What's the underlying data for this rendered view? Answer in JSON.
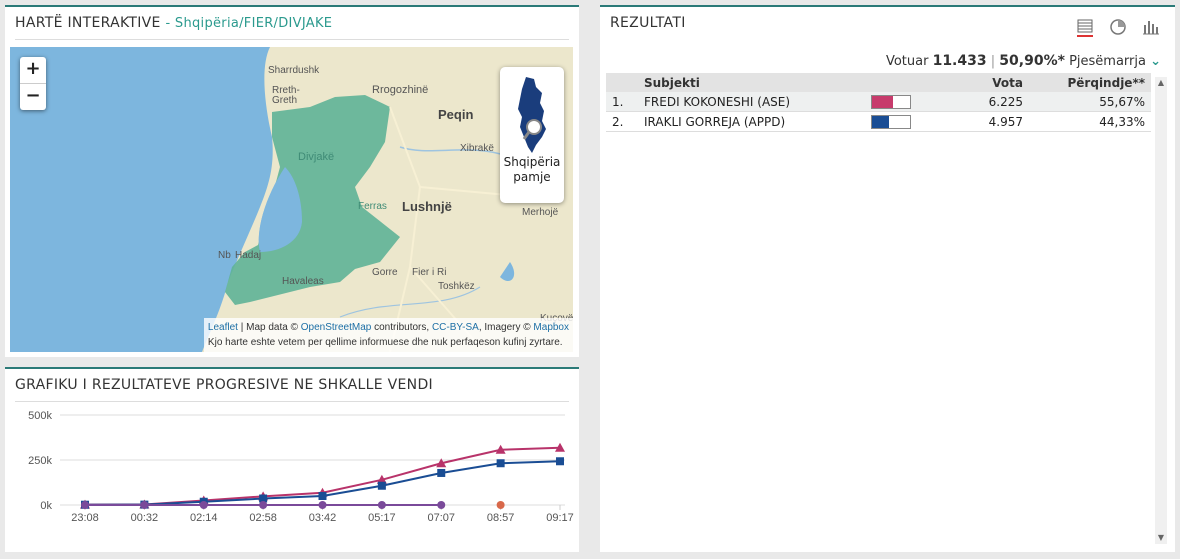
{
  "map_panel": {
    "title": "HARTË INTERAKTIVE",
    "breadcrumb": "- Shqipëria/FIER/DIVJAKE",
    "zoom_in": "+",
    "zoom_out": "−",
    "minimap_label_1": "Shqipëria",
    "minimap_label_2": "pamje",
    "places": [
      "Sharrdushk",
      "Rreth-",
      "Greth",
      "Rrogozhinë",
      "Peqin",
      "Xibrakë",
      "Divjakë",
      "Ferras",
      "Lushnjë",
      "Merhojë",
      "Hadaj",
      "Havaleas",
      "Gorre",
      "Fier i Ri",
      "Toshkëz",
      "Kuçovë",
      "Nb"
    ],
    "attr_leaflet": "Leaflet",
    "attr_mid": "| Map data ©",
    "attr_osm": "OpenStreetMap",
    "attr_contrib": "contributors,",
    "attr_cc": "CC-BY-SA",
    "attr_imagery": ", Imagery ©",
    "attr_mapbox": "Mapbox",
    "disclaimer": "Kjo harte eshte vetem per qellime informuese dhe nuk perfaqeson kufinj zyrtare."
  },
  "results_panel": {
    "title": "REZULTATI",
    "icons": [
      "table-view-icon",
      "pie-chart-icon",
      "bar-chart-icon"
    ],
    "voted_label": "Votuar",
    "voted_value": "11.433",
    "separator": "|",
    "turnout_value": "50,90%*",
    "turnout_label": "Pjesëmarrja",
    "columns": [
      "Subjekti",
      "Vota",
      "Përqindje**"
    ],
    "rows": [
      {
        "rank": "1.",
        "name": "FREDI KOKONESHI (ASE)",
        "votes": "6.225",
        "pct": "55,67%",
        "share": 0.5567,
        "color": "#c73b6c"
      },
      {
        "rank": "2.",
        "name": "IRAKLI GORREJA (APPD)",
        "votes": "4.957",
        "pct": "44,33%",
        "share": 0.4433,
        "color": "#1a4d94"
      }
    ]
  },
  "chart_panel": {
    "title": "GRAFIKU I REZULTATEVE PROGRESIVE NE SHKALLE VENDI"
  },
  "chart_data": {
    "type": "line",
    "title": "GRAFIKU I REZULTATEVE PROGRESIVE NE SHKALLE VENDI",
    "x": [
      "23:08",
      "00:32",
      "02:14",
      "02:58",
      "03:42",
      "05:17",
      "07:07",
      "08:57",
      "09:17"
    ],
    "ylim": [
      0,
      500000
    ],
    "yticks": [
      0,
      250000,
      500000
    ],
    "ytick_labels": [
      "0k",
      "250k",
      "500k"
    ],
    "grid": true,
    "series": [
      {
        "color": "#b8336a",
        "marker": "triangle",
        "values": [
          2000,
          3000,
          25000,
          48000,
          68000,
          140000,
          232000,
          307000,
          318000
        ]
      },
      {
        "color": "#1a4d94",
        "marker": "square",
        "values": [
          1500,
          2000,
          18000,
          36000,
          50000,
          107000,
          178000,
          232000,
          243000
        ]
      },
      {
        "color": "#7a4a9a",
        "marker": "circle",
        "values": [
          0,
          0,
          0,
          0,
          0,
          0,
          0,
          null,
          null
        ]
      },
      {
        "color": "#d8684a",
        "marker": "circle",
        "values": [
          null,
          null,
          null,
          null,
          null,
          null,
          null,
          0,
          null
        ]
      }
    ]
  }
}
